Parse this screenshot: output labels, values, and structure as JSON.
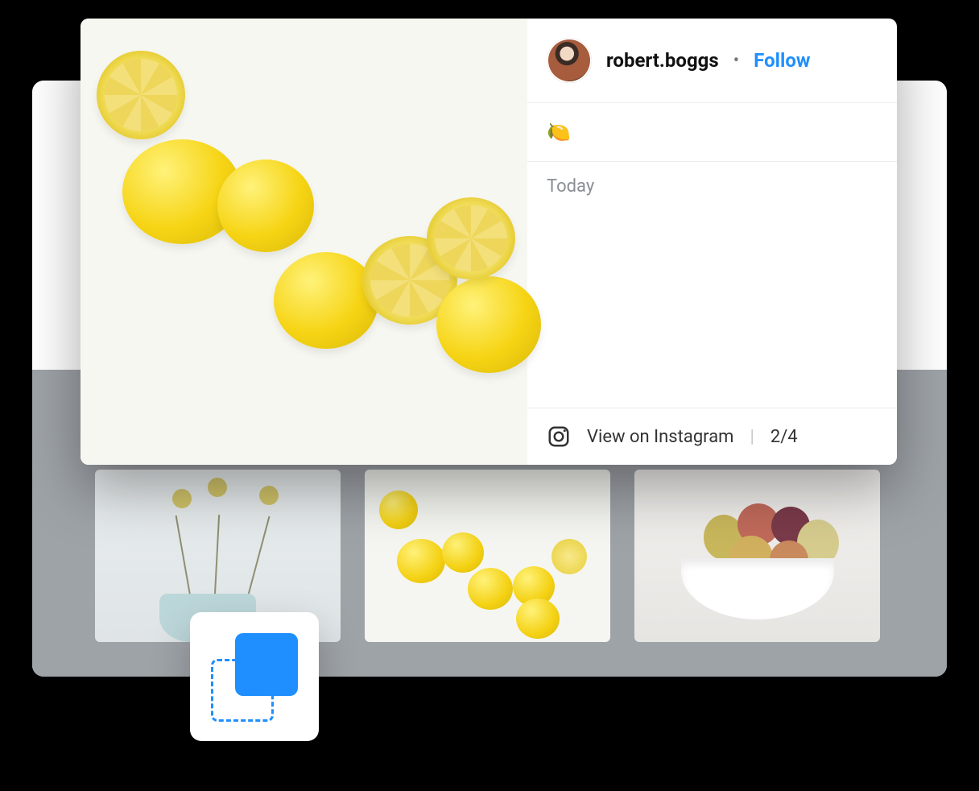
{
  "post": {
    "username": "robert.boggs",
    "separator": "•",
    "follow_label": "Follow",
    "caption": "🍋",
    "time_label": "Today",
    "view_label": "View on Instagram",
    "index": "2/4"
  },
  "icons": {
    "instagram": "instagram-icon",
    "popup": "popup-layers-icon"
  },
  "thumbnails": [
    {
      "alt": "vase-flowers"
    },
    {
      "alt": "lemons"
    },
    {
      "alt": "fruit-bowl"
    }
  ]
}
